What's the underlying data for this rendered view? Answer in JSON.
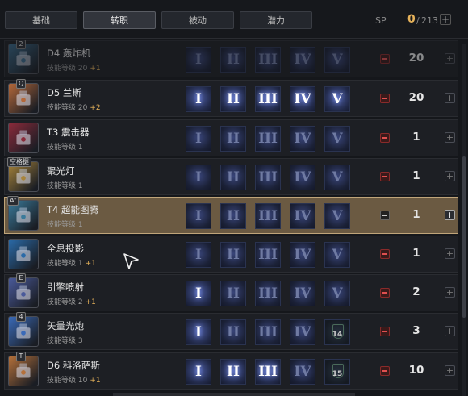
{
  "tabs": [
    {
      "label": "基础",
      "active": false
    },
    {
      "label": "转职",
      "active": true
    },
    {
      "label": "被动",
      "active": false
    },
    {
      "label": "潜力",
      "active": false
    }
  ],
  "sp": {
    "label": "SP",
    "value": "0",
    "separator": "/",
    "max": "213"
  },
  "numerals": [
    "I",
    "II",
    "III",
    "IV",
    "V"
  ],
  "skills": [
    {
      "key": "2",
      "name": "D4 轰炸机",
      "level_text": "技能等级 20",
      "bonus": "+1",
      "count": "20",
      "tiers_on": 0,
      "locks": [],
      "icon": "bomber-icon",
      "color": "#3a6a8a"
    },
    {
      "key": "Q",
      "name": "D5 兰斯",
      "level_text": "技能等级 20",
      "bonus": "+2",
      "count": "20",
      "tiers_on": 5,
      "locks": [],
      "icon": "lance-icon",
      "color": "#b4683a"
    },
    {
      "key": "",
      "name": "T3 震击器",
      "level_text": "技能等级 1",
      "bonus": "",
      "count": "1",
      "tiers_on": 0,
      "locks": [],
      "icon": "shocker-icon",
      "color": "#8a2a3a"
    },
    {
      "key": "空格键",
      "name": "聚光灯",
      "level_text": "技能等级 1",
      "bonus": "",
      "count": "1",
      "tiers_on": 0,
      "locks": [],
      "icon": "spotlight-icon",
      "color": "#a8843a"
    },
    {
      "key": "Af",
      "name": "T4 超能图腾",
      "level_text": "技能等级 1",
      "bonus": "",
      "count": "1",
      "tiers_on": 0,
      "locks": [],
      "icon": "totem-icon",
      "color": "#3a7a9a"
    },
    {
      "key": "",
      "name": "全息投影",
      "level_text": "技能等级 1",
      "bonus": "+1",
      "count": "1",
      "tiers_on": 0,
      "locks": [],
      "icon": "hologram-icon",
      "color": "#2a6aa8"
    },
    {
      "key": "E",
      "name": "引擎喷射",
      "level_text": "技能等级 2",
      "bonus": "+1",
      "count": "2",
      "tiers_on": 1,
      "locks": [],
      "icon": "engine-jet-icon",
      "color": "#4a5a9a"
    },
    {
      "key": "4",
      "name": "矢量光炮",
      "level_text": "技能等级 3",
      "bonus": "",
      "count": "3",
      "tiers_on": 1,
      "locks": [
        "14"
      ],
      "icon": "vector-cannon-icon",
      "color": "#3a6ab8"
    },
    {
      "key": "T",
      "name": "D6 科洛萨斯",
      "level_text": "技能等级 10",
      "bonus": "+1",
      "count": "10",
      "tiers_on": 3,
      "locks": [
        "15"
      ],
      "icon": "colossus-icon",
      "color": "#b4703a"
    }
  ]
}
